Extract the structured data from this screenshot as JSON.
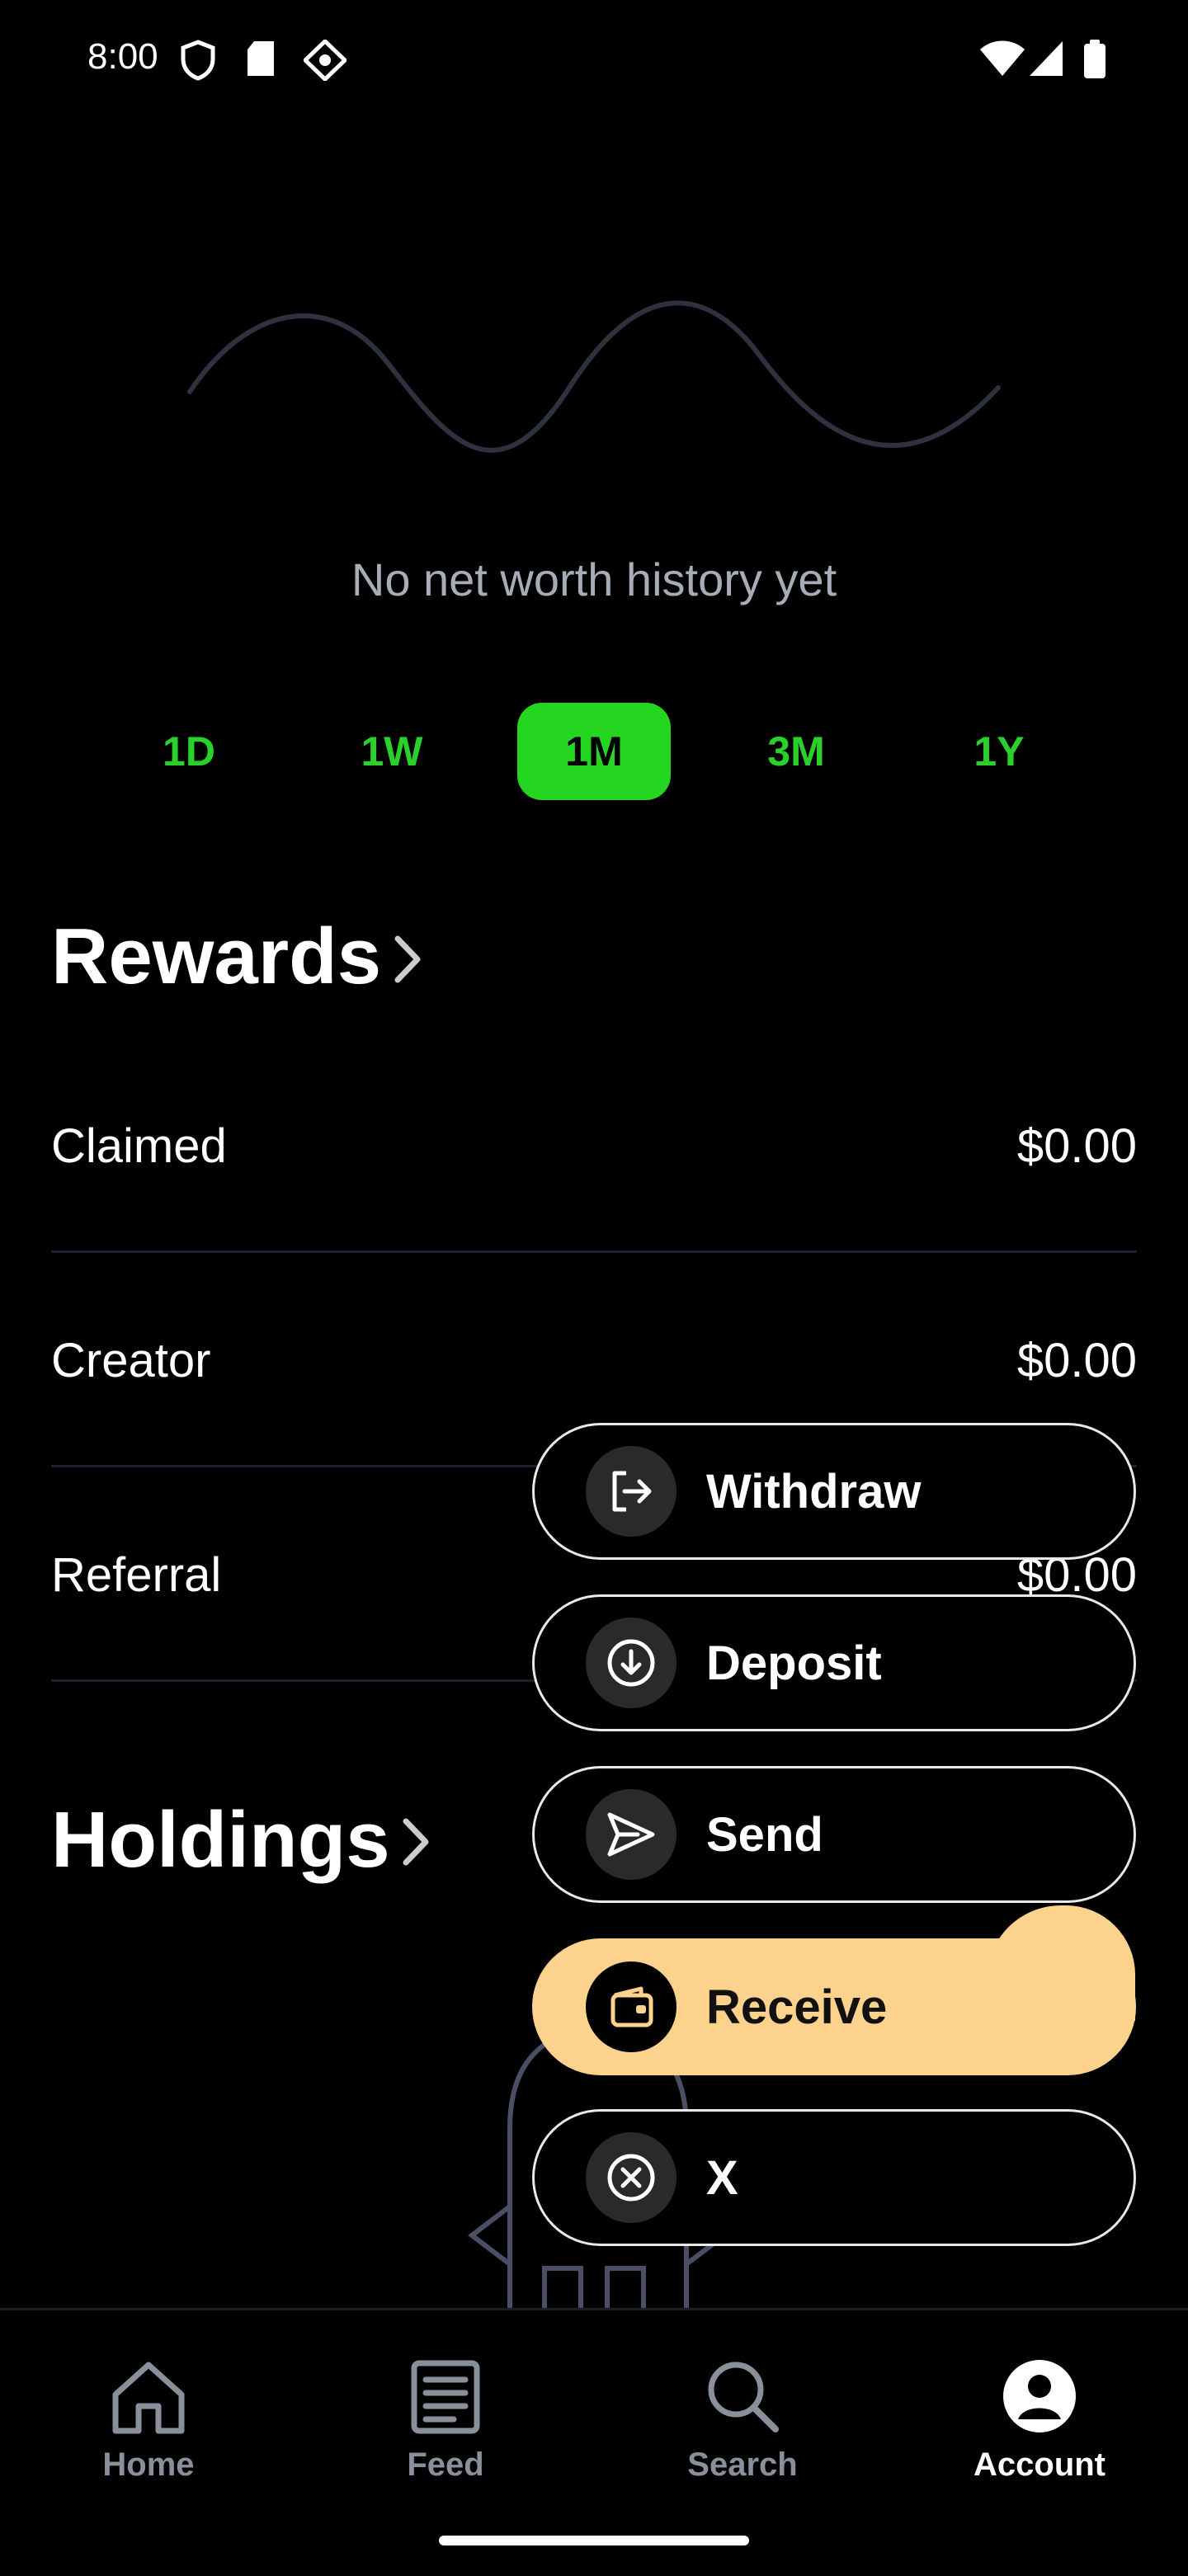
{
  "status_bar": {
    "time": "8:00"
  },
  "chart": {
    "empty_message": "No net worth history yet"
  },
  "range_selector": {
    "options": [
      "1D",
      "1W",
      "1M",
      "3M",
      "1Y"
    ],
    "selected": "1M"
  },
  "rewards": {
    "title": "Rewards",
    "rows": [
      {
        "label": "Claimed",
        "value": "$0.00"
      },
      {
        "label": "Creator",
        "value": "$0.00"
      },
      {
        "label": "Referral",
        "value": "$0.00"
      }
    ]
  },
  "holdings": {
    "title": "Holdings"
  },
  "action_menu": {
    "items": [
      {
        "label": "Withdraw",
        "icon": "logout-icon"
      },
      {
        "label": "Deposit",
        "icon": "arrow-down-circle-icon"
      },
      {
        "label": "Send",
        "icon": "send-icon"
      },
      {
        "label": "Receive",
        "icon": "wallet-icon"
      },
      {
        "label": "X",
        "icon": "close-circle-icon"
      }
    ],
    "accent_color": "#fdd28c"
  },
  "bottom_nav": {
    "items": [
      {
        "label": "Home",
        "icon": "home-icon"
      },
      {
        "label": "Feed",
        "icon": "newspaper-icon"
      },
      {
        "label": "Search",
        "icon": "search-icon"
      },
      {
        "label": "Account",
        "icon": "account-icon"
      }
    ],
    "active": "Account"
  },
  "colors": {
    "brand_green": "#24d620",
    "background": "#000000"
  }
}
